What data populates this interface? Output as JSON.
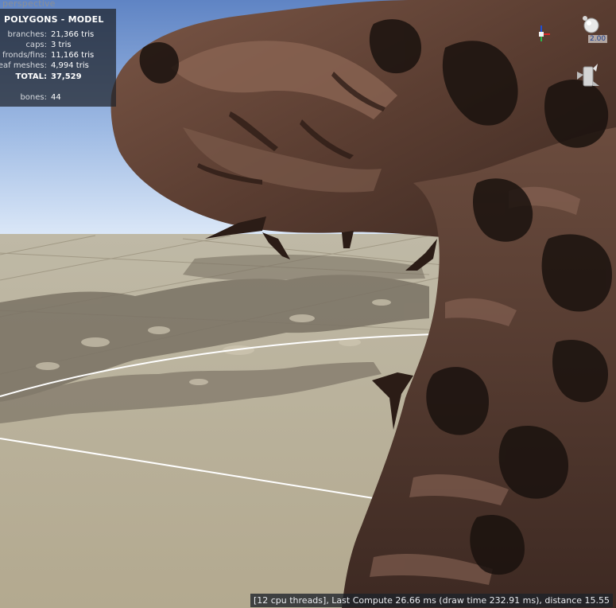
{
  "viewport": {
    "view_label": "perspective",
    "stats": {
      "title": "POLYGONS - MODEL",
      "rows": [
        {
          "key": "branches:",
          "value": "21,366 tris"
        },
        {
          "key": "caps:",
          "value": "3 tris"
        },
        {
          "key": "fronds/fins:",
          "value": "11,166 tris"
        },
        {
          "key": "leaf meshes:",
          "value": "4,994 tris"
        },
        {
          "key": "TOTAL:",
          "value": "37,529"
        },
        {
          "key": "bones:",
          "value": "44"
        }
      ]
    },
    "gizmo": {
      "value": "2.00",
      "sphere_icon": "light-sphere-icon",
      "fan_icon": "wind-fan-icon",
      "axes_icon": "axis-triad-icon"
    },
    "status": "[12 cpu threads], Last Compute 26.66 ms (draw time 232.91 ms), distance 15.55",
    "colors": {
      "sky_top": "#c9dcf7",
      "sky_bottom": "#7f9ecd",
      "ground": "#b8b09a",
      "bark_dark": "#3a251d",
      "bark_mid": "#6b4b3c",
      "panel": "#1e222a"
    }
  }
}
